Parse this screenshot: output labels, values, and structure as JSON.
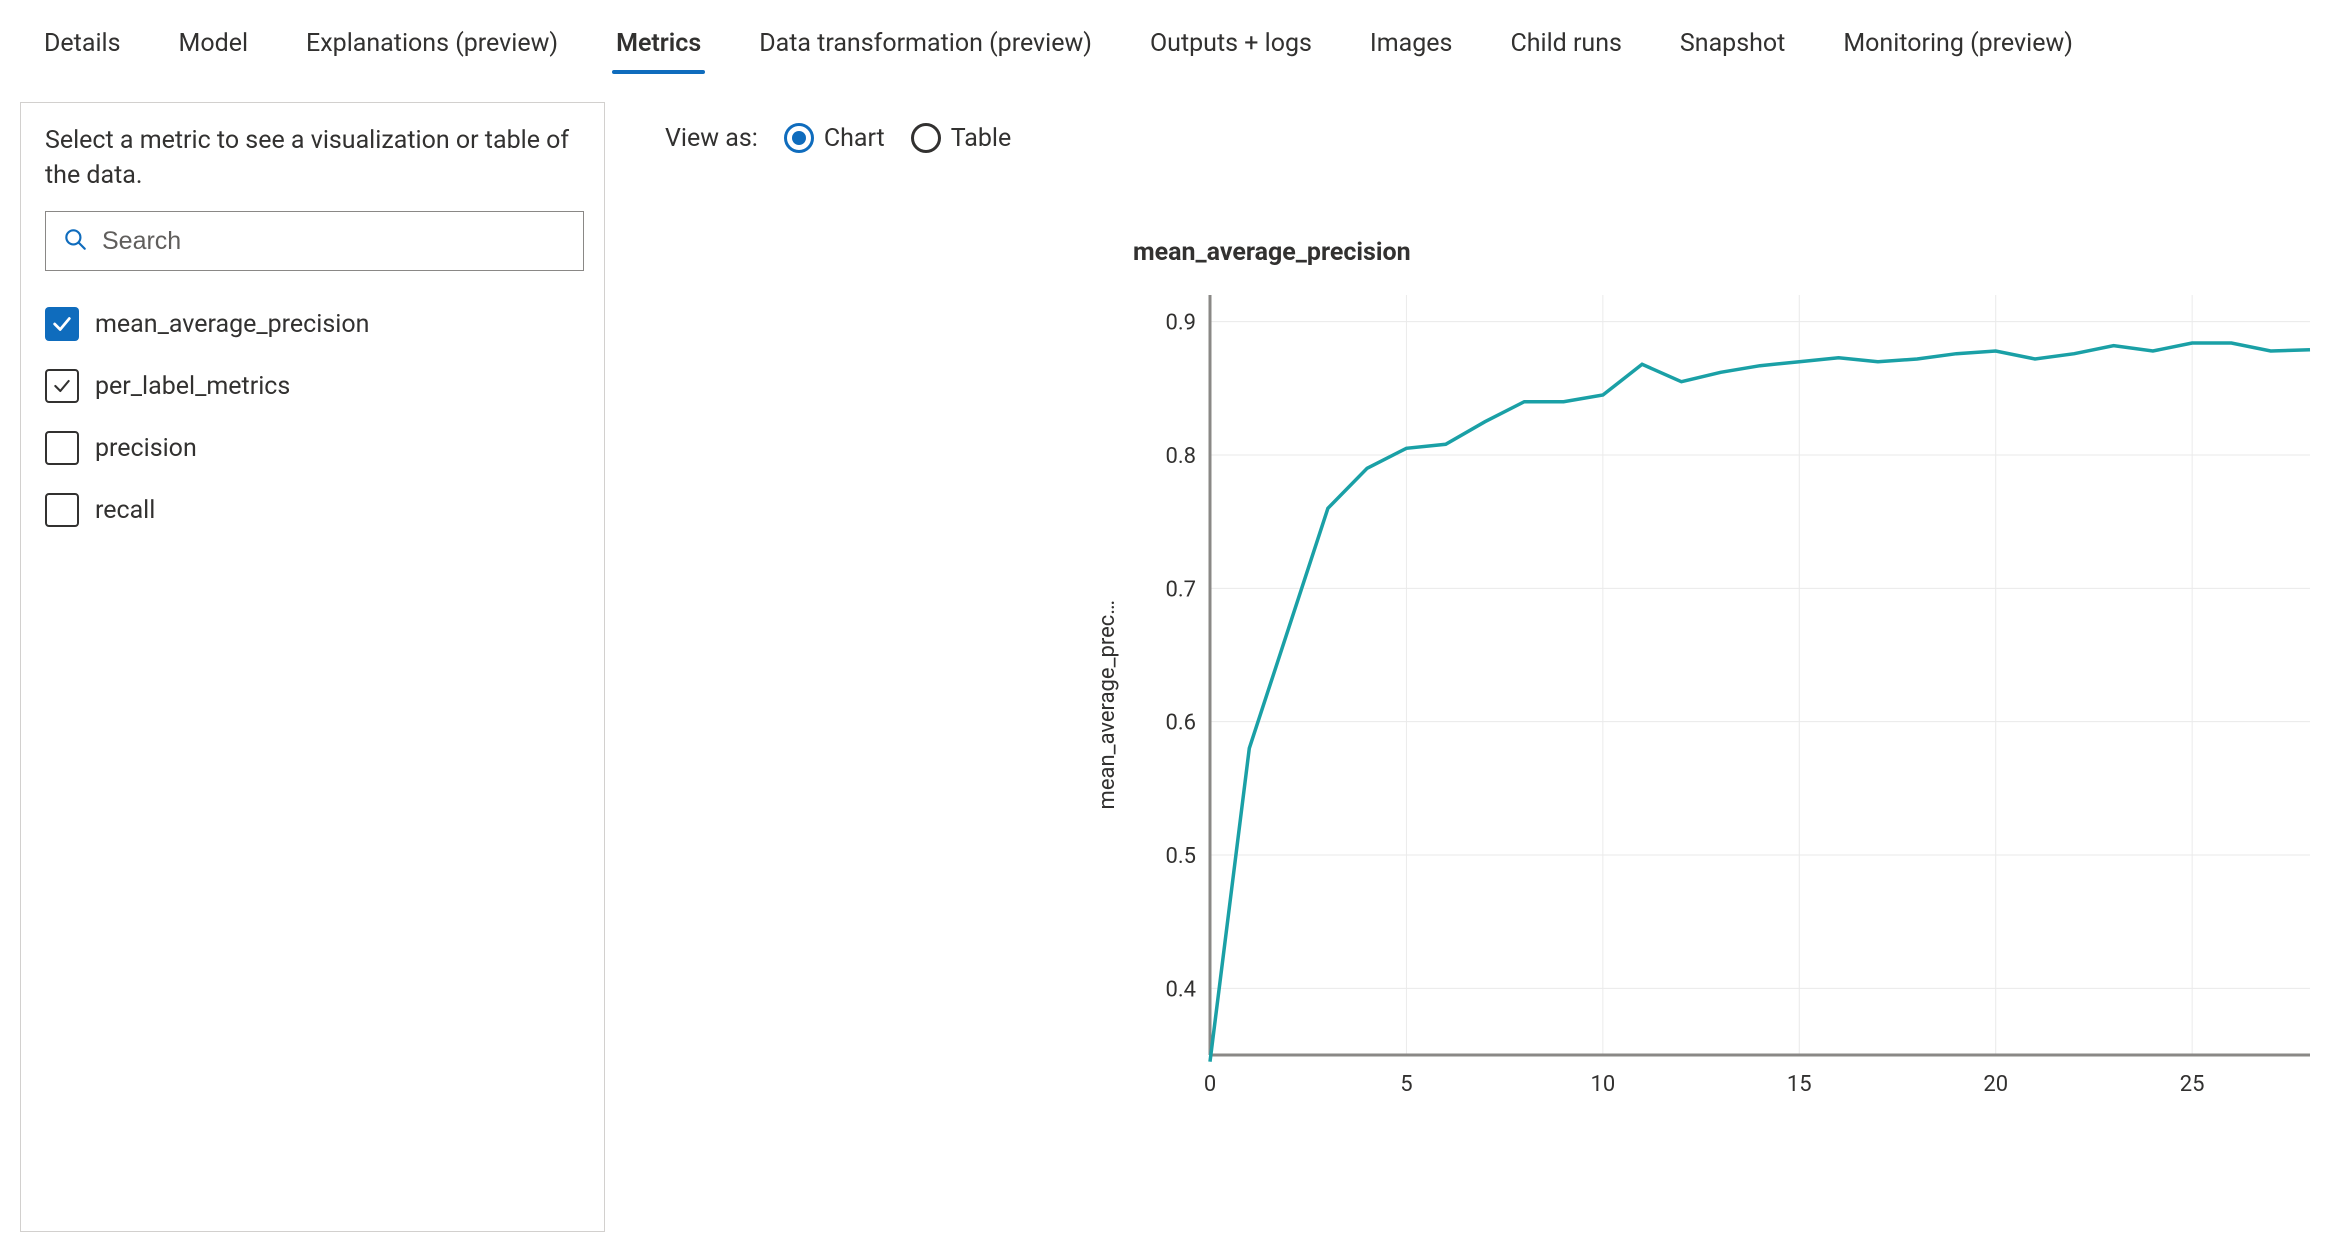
{
  "tabs": [
    {
      "id": "details",
      "label": "Details",
      "active": false
    },
    {
      "id": "model",
      "label": "Model",
      "active": false
    },
    {
      "id": "explanations",
      "label": "Explanations (preview)",
      "active": false
    },
    {
      "id": "metrics",
      "label": "Metrics",
      "active": true
    },
    {
      "id": "datatransform",
      "label": "Data transformation (preview)",
      "active": false
    },
    {
      "id": "outputs",
      "label": "Outputs + logs",
      "active": false
    },
    {
      "id": "images",
      "label": "Images",
      "active": false
    },
    {
      "id": "childruns",
      "label": "Child runs",
      "active": false
    },
    {
      "id": "snapshot",
      "label": "Snapshot",
      "active": false
    },
    {
      "id": "monitoring",
      "label": "Monitoring (preview)",
      "active": false
    }
  ],
  "sidebar": {
    "help_text": "Select a metric to see a visualization or table of the data.",
    "search_placeholder": "Search",
    "metrics": [
      {
        "id": "mean_average_precision",
        "label": "mean_average_precision",
        "state": "primary"
      },
      {
        "id": "per_label_metrics",
        "label": "per_label_metrics",
        "state": "secondary"
      },
      {
        "id": "precision",
        "label": "precision",
        "state": "empty"
      },
      {
        "id": "recall",
        "label": "recall",
        "state": "empty"
      }
    ]
  },
  "view_as": {
    "label": "View as:",
    "options": [
      {
        "id": "chart",
        "label": "Chart",
        "selected": true
      },
      {
        "id": "table",
        "label": "Table",
        "selected": false
      }
    ]
  },
  "colors": {
    "accent": "#0f6cbd",
    "line": "#1aa0a6",
    "text": "#323130",
    "grid": "#eaeaea",
    "axis": "#8a8886"
  },
  "chart_data": {
    "type": "line",
    "title": "mean_average_precision",
    "xlabel": "",
    "ylabel": "mean_average_prec…",
    "xlim": [
      0,
      28
    ],
    "ylim": [
      0.35,
      0.92
    ],
    "x_ticks": [
      0,
      5,
      10,
      15,
      20,
      25
    ],
    "y_ticks": [
      0.4,
      0.5,
      0.6,
      0.7,
      0.8,
      0.9
    ],
    "series": [
      {
        "name": "mean_average_precision",
        "color": "#1aa0a6",
        "x": [
          0,
          1,
          2,
          3,
          4,
          5,
          6,
          7,
          8,
          9,
          10,
          11,
          12,
          13,
          14,
          15,
          16,
          17,
          18,
          19,
          20,
          21,
          22,
          23,
          24,
          25,
          26,
          27,
          28
        ],
        "values": [
          0.345,
          0.58,
          0.67,
          0.76,
          0.79,
          0.805,
          0.808,
          0.825,
          0.84,
          0.84,
          0.845,
          0.868,
          0.855,
          0.862,
          0.867,
          0.87,
          0.873,
          0.87,
          0.872,
          0.876,
          0.878,
          0.872,
          0.876,
          0.882,
          0.878,
          0.884,
          0.884,
          0.878,
          0.879
        ]
      }
    ]
  }
}
